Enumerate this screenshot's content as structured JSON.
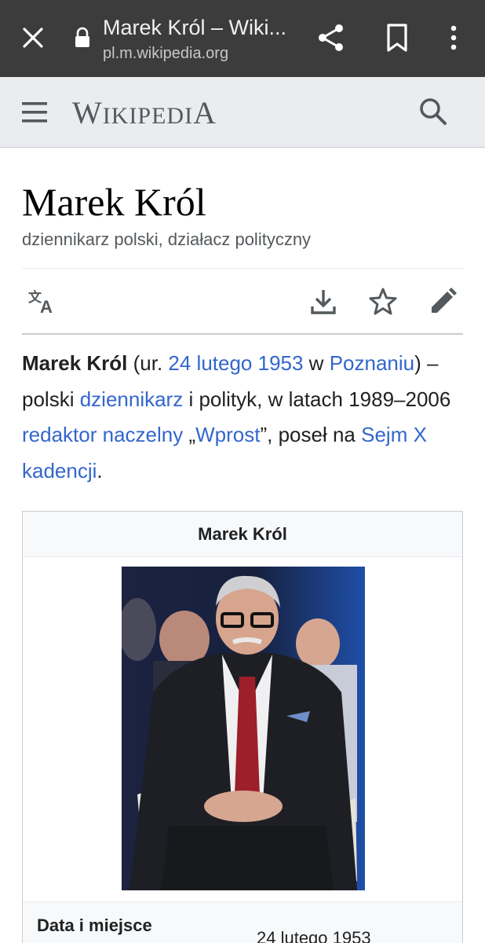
{
  "browser": {
    "tab_title": "Marek Król – Wiki...",
    "url": "pl.m.wikipedia.org",
    "icons": [
      "close-icon",
      "lock-icon",
      "share-icon",
      "bookmark-icon",
      "more-vert-icon"
    ],
    "bar_color": "#3c3c3c"
  },
  "header": {
    "wordmark_first": "W",
    "wordmark_mid": "IKIPEDI",
    "wordmark_last": "A",
    "icons": [
      "menu-icon",
      "search-icon"
    ],
    "background": "#eaecf0"
  },
  "page": {
    "title": "Marek Król",
    "description": "dziennikarz polski, działacz polityczny"
  },
  "actions": {
    "icons": [
      "language-icon",
      "download-icon",
      "star-icon",
      "edit-icon"
    ]
  },
  "article": {
    "subject": "Marek Król",
    "t1": " (ur. ",
    "l_date": "24 lutego 1953",
    "t2": " w ",
    "l_city": "Poznaniu",
    "t3": ") – polski ",
    "l_journalist": "dziennikarz",
    "t4": " i polityk, w latach 1989–2006 ",
    "l_editor": "redaktor naczelny",
    "t5": " „",
    "l_wprost": "Wprost",
    "t6": "”, poseł na ",
    "l_sejm": "Sejm X kadencji",
    "t7": ".",
    "link_color": "#3366cc"
  },
  "infobox": {
    "title": "Marek Król",
    "row_label": "Data i miejsce",
    "row_value": "24 lutego 1953"
  }
}
